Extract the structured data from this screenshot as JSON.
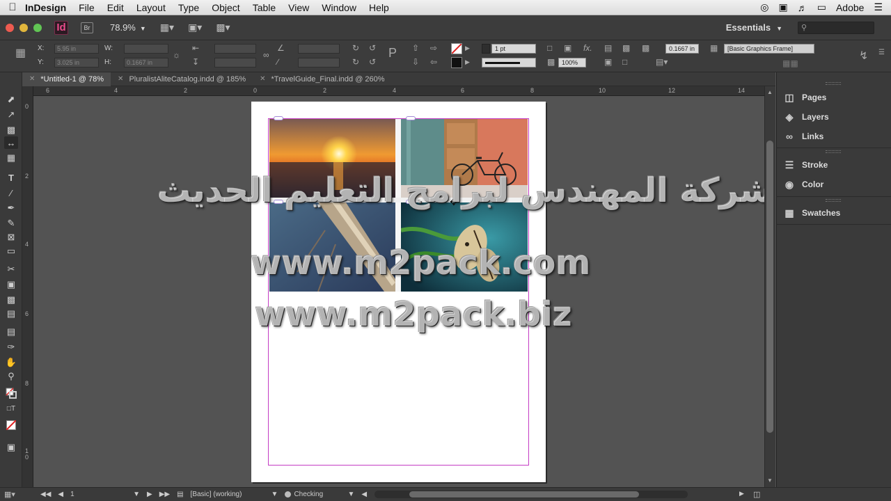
{
  "menubar": {
    "app_name": "InDesign",
    "items": [
      "File",
      "Edit",
      "Layout",
      "Type",
      "Object",
      "Table",
      "View",
      "Window",
      "Help"
    ],
    "right_label": "Adobe"
  },
  "appbar": {
    "bridge_label": "Br",
    "app_logo": "Id",
    "zoom": "78.9%",
    "workspace": "Essentials"
  },
  "control": {
    "x_label": "X:",
    "x_value": "5.95 in",
    "y_label": "Y:",
    "y_value": "3.025 in",
    "w_label": "W:",
    "h_label": "H:",
    "h_value": "0.1667 in",
    "stroke_weight": "1 pt",
    "opacity": "100%",
    "gap_value": "0.1667 in",
    "object_style": "[Basic Graphics Frame]"
  },
  "tabs": [
    {
      "label": "*Untitled-1 @ 78%",
      "active": true
    },
    {
      "label": "PluralistAliteCatalog.indd @ 185%",
      "active": false
    },
    {
      "label": "*TravelGuide_Final.indd @ 260%",
      "active": false
    }
  ],
  "hruler": [
    "6",
    "4",
    "2",
    "0",
    "2",
    "4",
    "6",
    "8",
    "10",
    "12",
    "14"
  ],
  "vruler": [
    "0",
    "2",
    "4",
    "6",
    "8",
    "1\n0"
  ],
  "watermark": {
    "arabic": "شركة المهندس لبرامج التعليم الحديث",
    "url1": "www.m2pack.com",
    "url2": "www.m2pack.biz"
  },
  "panels": [
    {
      "label": "Pages",
      "icon": "pages-icon"
    },
    {
      "label": "Layers",
      "icon": "layers-icon"
    },
    {
      "label": "Links",
      "icon": "links-icon"
    },
    {
      "label": "Stroke",
      "icon": "stroke-icon"
    },
    {
      "label": "Color",
      "icon": "color-icon"
    },
    {
      "label": "Swatches",
      "icon": "swatches-icon"
    }
  ],
  "statusbar": {
    "page_number": "1",
    "preflight_profile": "[Basic] (working)",
    "preflight_status": "Checking"
  }
}
